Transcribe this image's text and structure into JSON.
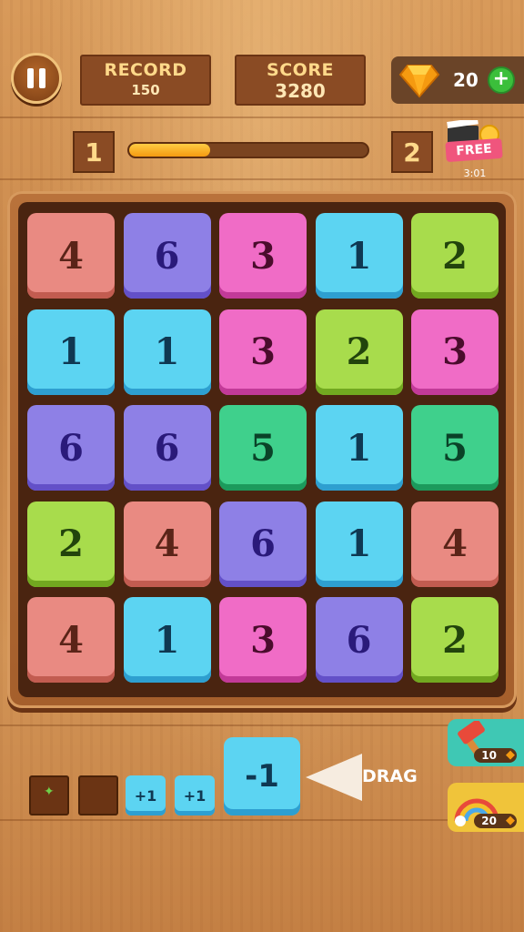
{
  "header": {
    "record_label": "RECORD",
    "record_value": "150",
    "score_label": "SCORE",
    "score_value": "3280",
    "gems": "20",
    "plus": "+"
  },
  "level": {
    "current": "1",
    "next": "2",
    "progress": 0.34
  },
  "free_reward": {
    "label": "FREE",
    "timer": "3:01"
  },
  "board": {
    "rows": [
      [
        4,
        6,
        3,
        1,
        2
      ],
      [
        1,
        1,
        3,
        2,
        3
      ],
      [
        6,
        6,
        5,
        1,
        5
      ],
      [
        2,
        4,
        6,
        1,
        4
      ],
      [
        4,
        1,
        3,
        6,
        2
      ]
    ]
  },
  "tray": {
    "plus_one_a": "+1",
    "plus_one_b": "+1",
    "drag_tile": "-1",
    "drag_label": "DRAG"
  },
  "powerups": {
    "hammer_cost": "10",
    "rainbow_cost": "20"
  },
  "colors": {
    "1": "#5cd4f2",
    "2": "#a8dc4c",
    "3": "#f06cc6",
    "4": "#e98a82",
    "5": "#3fd08c",
    "6": "#8e80e6"
  }
}
